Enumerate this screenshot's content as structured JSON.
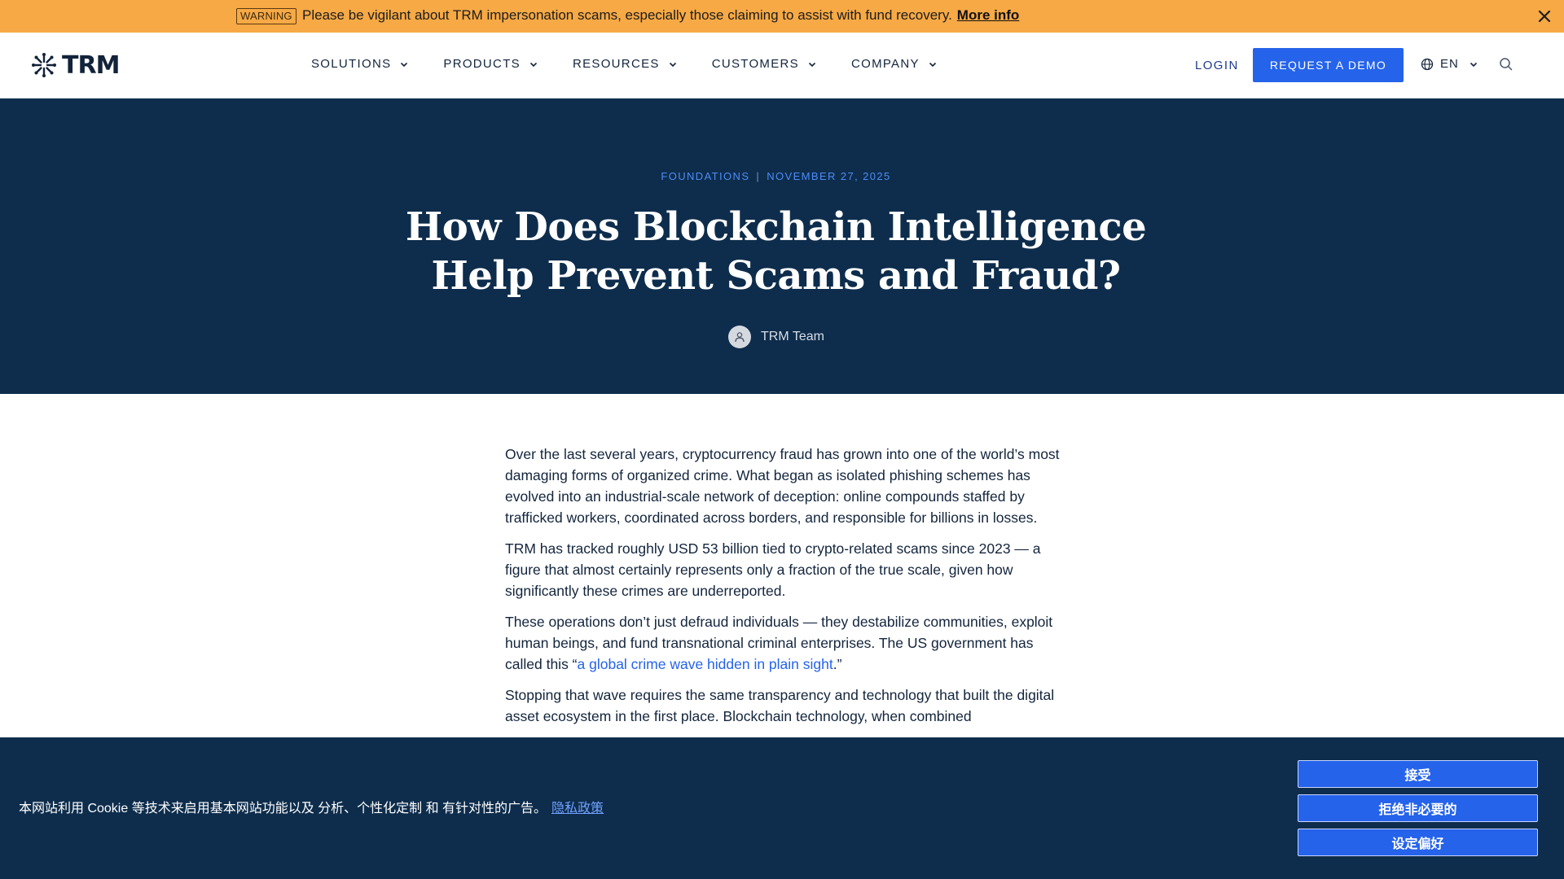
{
  "warning": {
    "badge": "WARNING",
    "message": "Please be vigilant about TRM impersonation scams, especially those claiming to assist with fund recovery.",
    "link": "More info",
    "close_icon": "close-icon"
  },
  "nav": {
    "logo_text": "TRM",
    "menu": [
      {
        "label": "SOLUTIONS"
      },
      {
        "label": "PRODUCTS"
      },
      {
        "label": "RESOURCES"
      },
      {
        "label": "CUSTOMERS"
      },
      {
        "label": "COMPANY"
      }
    ],
    "login": "LOGIN",
    "demo": "REQUEST A DEMO",
    "lang": "EN",
    "search_icon": "search-icon"
  },
  "hero": {
    "category": "FOUNDATIONS",
    "date": "NOVEMBER 27, 2025",
    "title": "How Does Blockchain Intelligence Help Prevent Scams and Fraud?",
    "author": "TRM Team"
  },
  "article": {
    "p1": "Over the last several years, cryptocurrency fraud has grown into one of the world’s most damaging forms of organized crime. What began as isolated phishing schemes has evolved into an industrial-scale network of deception: online compounds staffed by trafficked workers, coordinated across borders, and responsible for billions in losses.",
    "p2": "TRM has tracked roughly USD 53 billion tied to crypto-related scams since 2023 — a figure that almost certainly represents only a fraction of the true scale, given how significantly these crimes are underreported.",
    "p3_before": "These operations don’t just defraud individuals — they destabilize communities, exploit human beings, and fund transnational criminal enterprises. The US government has called this “",
    "p3_link": "a global crime wave hidden in plain sight",
    "p3_after": ".”",
    "p4": "Stopping that wave requires the same transparency and technology that built the digital asset ecosystem in the first place. Blockchain technology, when combined"
  },
  "cookie": {
    "text": "本网站利用 Cookie 等技术来启用基本网站功能以及 分析、个性化定制 和 有针对性的广告。",
    "policy_link": "隐私政策",
    "accept": "接受",
    "reject": "拒绝非必要的",
    "preferences": "设定偏好"
  },
  "colors": {
    "warning_bg": "#f6a945",
    "hero_bg": "#0e2d4c",
    "accent": "#2563eb"
  }
}
